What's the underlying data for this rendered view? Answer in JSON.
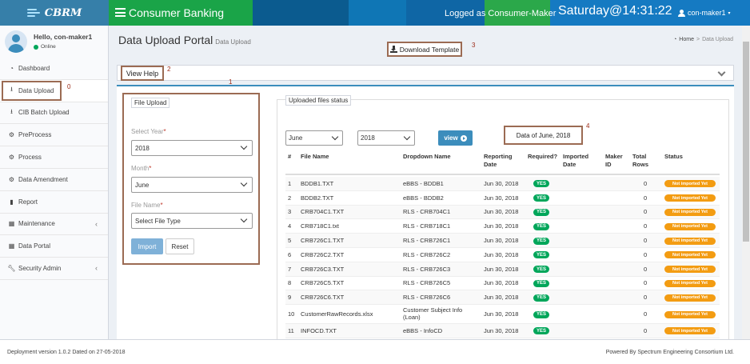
{
  "logo": {
    "text": "CBRM"
  },
  "header": {
    "app_title": "Consumer Banking",
    "logged_as": "Logged as Consumer-Maker",
    "clock": "Saturday@14:31:22",
    "user": "con-maker1"
  },
  "sidebar": {
    "greeting": "Hello, con-maker1",
    "status": "Online",
    "items": [
      {
        "label": "Dashboard",
        "icon": "dashboard-icon"
      },
      {
        "label": "Data Upload",
        "icon": "upload-icon"
      },
      {
        "label": "CIB Batch Upload",
        "icon": "upload-icon"
      },
      {
        "label": "PreProcess",
        "icon": "gears-icon"
      },
      {
        "label": "Process",
        "icon": "gear-icon"
      },
      {
        "label": "Data Amendment",
        "icon": "gear-icon"
      },
      {
        "label": "Report",
        "icon": "bar-chart-icon"
      },
      {
        "label": "Maintenance",
        "icon": "grid-icon"
      },
      {
        "label": "Data Portal",
        "icon": "grid-icon"
      },
      {
        "label": "Security Admin",
        "icon": "wrench-icon"
      }
    ]
  },
  "page": {
    "title": "Data Upload Portal",
    "subtitle": "Data Upload",
    "breadcrumb_home": "Home",
    "breadcrumb_current": "Data Upload",
    "download_template": "Download Template",
    "view_help": "View Help"
  },
  "callouts": [
    "0",
    "1",
    "2",
    "3",
    "4"
  ],
  "file_upload": {
    "legend": "File Upload",
    "year_label": "Select Year",
    "year_value": "2018",
    "month_label": "Month",
    "month_value": "June",
    "file_label": "File Name",
    "file_value": "Select File Type",
    "import_label": "Import",
    "reset_label": "Reset",
    "required_mark": "*"
  },
  "status_panel": {
    "legend": "Uploaded files status",
    "month_filter": "June",
    "year_filter": "2018",
    "view_label": "view",
    "data_of": "Data of June, 2018"
  },
  "table": {
    "headers": [
      "#",
      "File Name",
      "Dropdown Name",
      "Reporting Date",
      "Required?",
      "Imported Date",
      "Maker ID",
      "Total Rows",
      "Status"
    ],
    "rows": [
      {
        "num": "1",
        "file": "BDDB1.TXT",
        "dropdown": "eBBS - BDDB1",
        "date": "Jun 30, 2018",
        "required": "YES",
        "imported": "",
        "maker": "",
        "total": "0",
        "status": "Not imported Yet"
      },
      {
        "num": "2",
        "file": "BDDB2.TXT",
        "dropdown": "eBBS - BDDB2",
        "date": "Jun 30, 2018",
        "required": "YES",
        "imported": "",
        "maker": "",
        "total": "0",
        "status": "Not imported Yet"
      },
      {
        "num": "3",
        "file": "CRB704C1.TXT",
        "dropdown": "RLS - CRB704C1",
        "date": "Jun 30, 2018",
        "required": "YES",
        "imported": "",
        "maker": "",
        "total": "0",
        "status": "Not imported Yet"
      },
      {
        "num": "4",
        "file": "CRB718C1.txt",
        "dropdown": "RLS - CRB718C1",
        "date": "Jun 30, 2018",
        "required": "YES",
        "imported": "",
        "maker": "",
        "total": "0",
        "status": "Not imported Yet"
      },
      {
        "num": "5",
        "file": "CRB726C1.TXT",
        "dropdown": "RLS - CRB726C1",
        "date": "Jun 30, 2018",
        "required": "YES",
        "imported": "",
        "maker": "",
        "total": "0",
        "status": "Not imported Yet"
      },
      {
        "num": "6",
        "file": "CRB726C2.TXT",
        "dropdown": "RLS - CRB726C2",
        "date": "Jun 30, 2018",
        "required": "YES",
        "imported": "",
        "maker": "",
        "total": "0",
        "status": "Not imported Yet"
      },
      {
        "num": "7",
        "file": "CRB726C3.TXT",
        "dropdown": "RLS - CRB726C3",
        "date": "Jun 30, 2018",
        "required": "YES",
        "imported": "",
        "maker": "",
        "total": "0",
        "status": "Not imported Yet"
      },
      {
        "num": "8",
        "file": "CRB726C5.TXT",
        "dropdown": "RLS - CRB726C5",
        "date": "Jun 30, 2018",
        "required": "YES",
        "imported": "",
        "maker": "",
        "total": "0",
        "status": "Not imported Yet"
      },
      {
        "num": "9",
        "file": "CRB726C6.TXT",
        "dropdown": "RLS - CRB726C6",
        "date": "Jun 30, 2018",
        "required": "YES",
        "imported": "",
        "maker": "",
        "total": "0",
        "status": "Not imported Yet"
      },
      {
        "num": "10",
        "file": "CustomerRawRecords.xlsx",
        "dropdown": "Customer Subject Info (Loan)",
        "date": "Jun 30, 2018",
        "required": "YES",
        "imported": "",
        "maker": "",
        "total": "0",
        "status": "Not imported Yet"
      },
      {
        "num": "11",
        "file": "INFOCD.TXT",
        "dropdown": "eBBS - InfoCD",
        "date": "Jun 30, 2018",
        "required": "YES",
        "imported": "",
        "maker": "",
        "total": "0",
        "status": "Not imported Yet"
      }
    ]
  },
  "footer": {
    "left": "Deployment version 1.0.2 Dated on 27-05-2018",
    "right": "Powered By Spectrum Engineering Consortium Ltd."
  }
}
